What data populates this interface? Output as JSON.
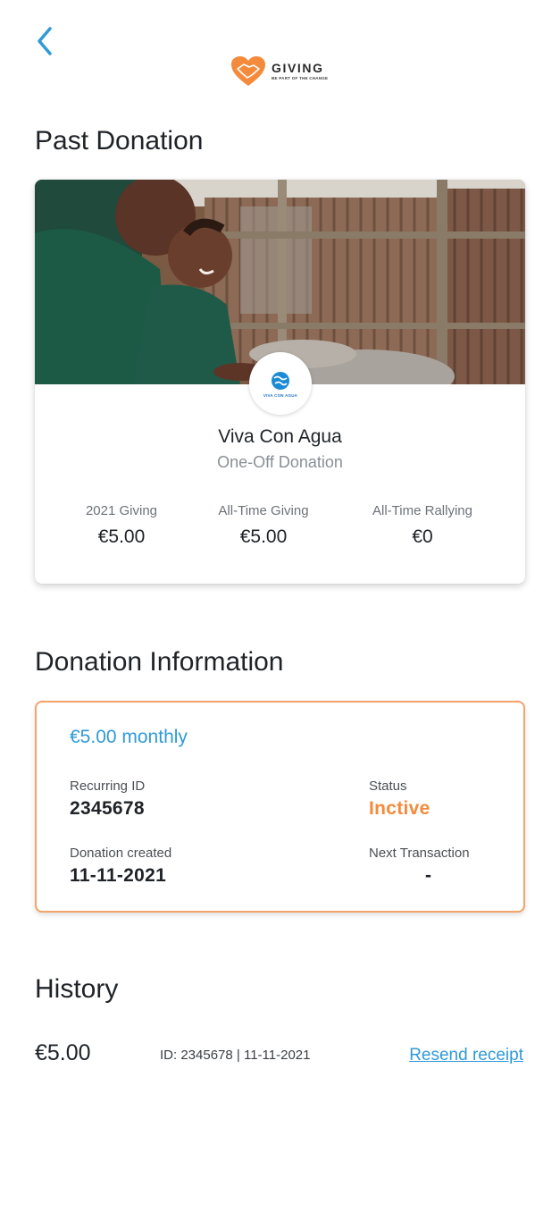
{
  "header": {
    "back_icon": "chevron-left-icon",
    "logo": {
      "name": "GIVING",
      "tagline": "BE PART OF THE CHANGE",
      "icon": "heart-handshake-icon"
    }
  },
  "past_donation": {
    "title": "Past Donation",
    "image": "children-at-water-tap-photo",
    "org_logo_text": "VIVA CON AGUA",
    "org_name": "Viva Con Agua",
    "donation_type": "One-Off Donation",
    "stats": [
      {
        "label": "2021 Giving",
        "value": "€5.00"
      },
      {
        "label": "All-Time Giving",
        "value": "€5.00"
      },
      {
        "label": "All-Time Rallying",
        "value": "€0"
      }
    ]
  },
  "donation_info": {
    "title": "Donation Information",
    "amount": "€5.00 monthly",
    "recurring_id_label": "Recurring ID",
    "recurring_id": "2345678",
    "status_label": "Status",
    "status": "Inctive",
    "created_label": "Donation created",
    "created": "11-11-2021",
    "next_label": "Next Transaction",
    "next": "-"
  },
  "history": {
    "title": "History",
    "items": [
      {
        "amount": "€5.00",
        "meta": "ID: 2345678 | 11-11-2021",
        "action": "Resend receipt"
      }
    ]
  },
  "colors": {
    "accent_blue": "#2f9ad8",
    "accent_orange": "#f58a3a",
    "card_border": "#f4a36a"
  }
}
